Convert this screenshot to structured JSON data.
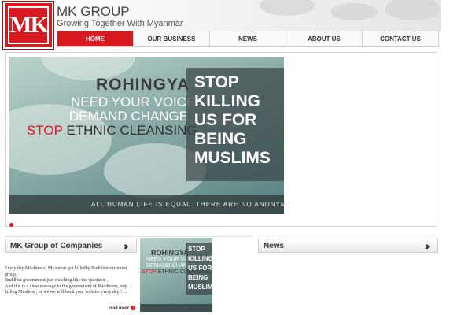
{
  "header": {
    "logo_text": "MK",
    "company_name": "MK GROUP",
    "slogan": "Growing Together With Myanmar"
  },
  "nav": {
    "items": [
      {
        "label": "HOME",
        "active": true
      },
      {
        "label": "OUR BUSINESS",
        "active": false
      },
      {
        "label": "NEWS",
        "active": false
      },
      {
        "label": "ABOUT US",
        "active": false
      },
      {
        "label": "CONTACT US",
        "active": false
      }
    ]
  },
  "banner": {
    "line1": "ROHINGYA",
    "line2": "NEED YOUR VOICE",
    "line3": "DEMAND CHANGE",
    "line4_stop": "STOP",
    "line4_rest": " ETHNIC CLEANSING",
    "box_lines": [
      "STOP",
      "KILLING",
      "US FOR",
      "BEING",
      "MUSLIMS"
    ],
    "strip_text": "ALL HUMAN LIFE IS EQUAL. THERE ARE NO ANONYMOUS CASUALTI",
    "active_slide": 1
  },
  "companies": {
    "title": "MK Group of Companies",
    "text_lines": [
      "Every day Muslims of Myanmar got killedby Buddhist extremist group.",
      "Buddhist government just watching like the spectator ,",
      "And this is a clear message to the government of Buddhism, stop killing Muslims , or we we will hack your website every day ! ..."
    ],
    "read_more": "read more"
  },
  "news": {
    "title": "News"
  },
  "colors": {
    "brand_red": "#d71920",
    "nav_border": "#cfcfcf"
  },
  "icons": {
    "section_arrow": "double-chevron-right-icon",
    "read_more_arrow": "circle-arrow-icon"
  }
}
